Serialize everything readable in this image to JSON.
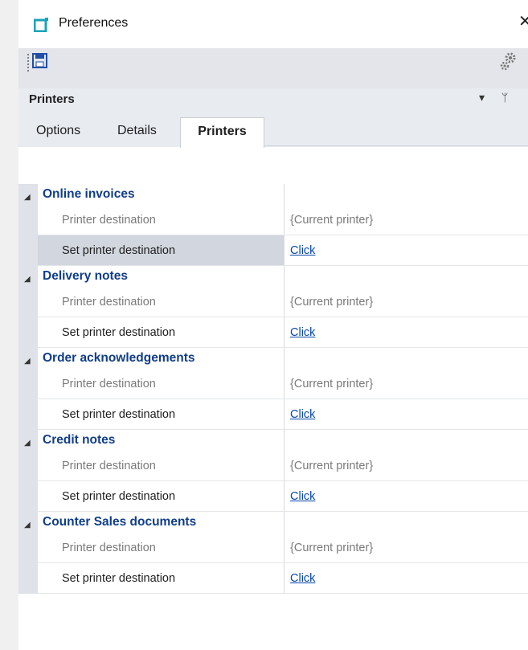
{
  "window": {
    "title": "Preferences",
    "close_glyph": "✕"
  },
  "toolbar": {
    "save_icon": "save-icon",
    "settings_icon": "gear-icon"
  },
  "panel": {
    "title": "Printers",
    "dropdown_glyph": "▾",
    "pin_glyph": "ᛘ"
  },
  "tabs": [
    {
      "label": "Options",
      "active": false
    },
    {
      "label": "Details",
      "active": false
    },
    {
      "label": "Printers",
      "active": true
    }
  ],
  "sections": [
    {
      "title": "Online invoices",
      "rows": [
        {
          "name": "Printer destination",
          "value": "{Current printer}",
          "kind": "readonly"
        },
        {
          "name": "Set printer destination",
          "value": "Click",
          "kind": "link",
          "selected": true
        }
      ]
    },
    {
      "title": "Delivery notes",
      "rows": [
        {
          "name": "Printer destination",
          "value": "{Current printer}",
          "kind": "readonly"
        },
        {
          "name": "Set printer destination",
          "value": "Click",
          "kind": "link"
        }
      ]
    },
    {
      "title": "Order acknowledgements",
      "rows": [
        {
          "name": "Printer destination",
          "value": "{Current printer}",
          "kind": "readonly"
        },
        {
          "name": "Set printer destination",
          "value": "Click",
          "kind": "link"
        }
      ]
    },
    {
      "title": "Credit notes",
      "rows": [
        {
          "name": "Printer destination",
          "value": "{Current printer}",
          "kind": "readonly"
        },
        {
          "name": "Set printer destination",
          "value": "Click",
          "kind": "link"
        }
      ]
    },
    {
      "title": "Counter Sales documents",
      "rows": [
        {
          "name": "Printer destination",
          "value": "{Current printer}",
          "kind": "readonly"
        },
        {
          "name": "Set printer destination",
          "value": "Click",
          "kind": "link"
        }
      ]
    }
  ],
  "colors": {
    "category_text": "#0f3d8c",
    "link": "#0645ad",
    "toolbar_bg": "#e3e5ea",
    "accent_icon": "#1aa3b8"
  }
}
